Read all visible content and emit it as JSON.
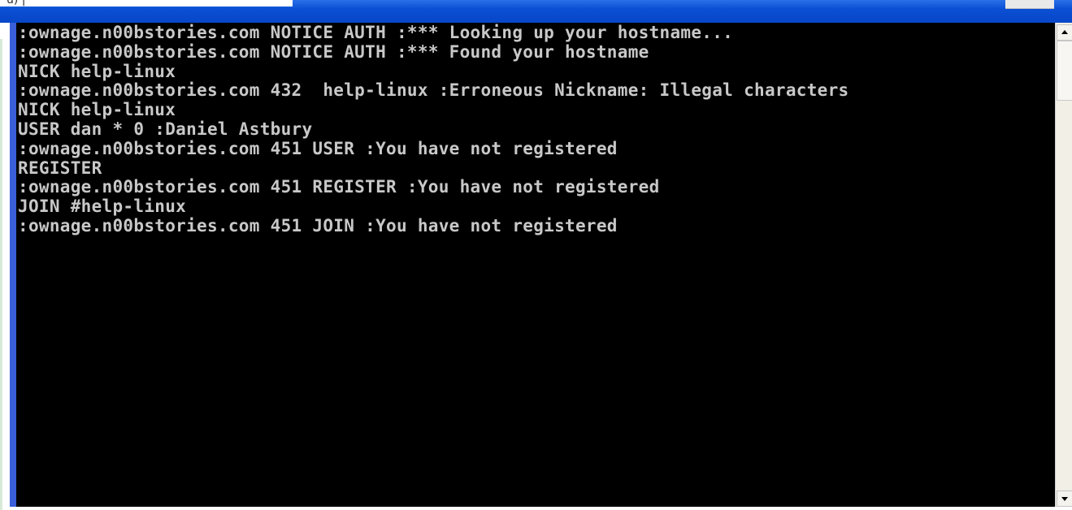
{
  "window": {
    "title_fragment": "u) |"
  },
  "console": {
    "lines": [
      ":ownage.n00bstories.com NOTICE AUTH :*** Looking up your hostname...",
      ":ownage.n00bstories.com NOTICE AUTH :*** Found your hostname",
      "NICK help-linux",
      ":ownage.n00bstories.com 432  help-linux :Erroneous Nickname: Illegal characters",
      "NICK help-linux",
      "USER dan * 0 :Daniel Astbury",
      ":ownage.n00bstories.com 451 USER :You have not registered",
      "REGISTER",
      ":ownage.n00bstories.com 451 REGISTER :You have not registered",
      "JOIN #help-linux",
      ":ownage.n00bstories.com 451 JOIN :You have not registered"
    ]
  },
  "scrollbar": {
    "up_icon": "scroll-up-arrow",
    "down_icon": "scroll-down-arrow"
  }
}
